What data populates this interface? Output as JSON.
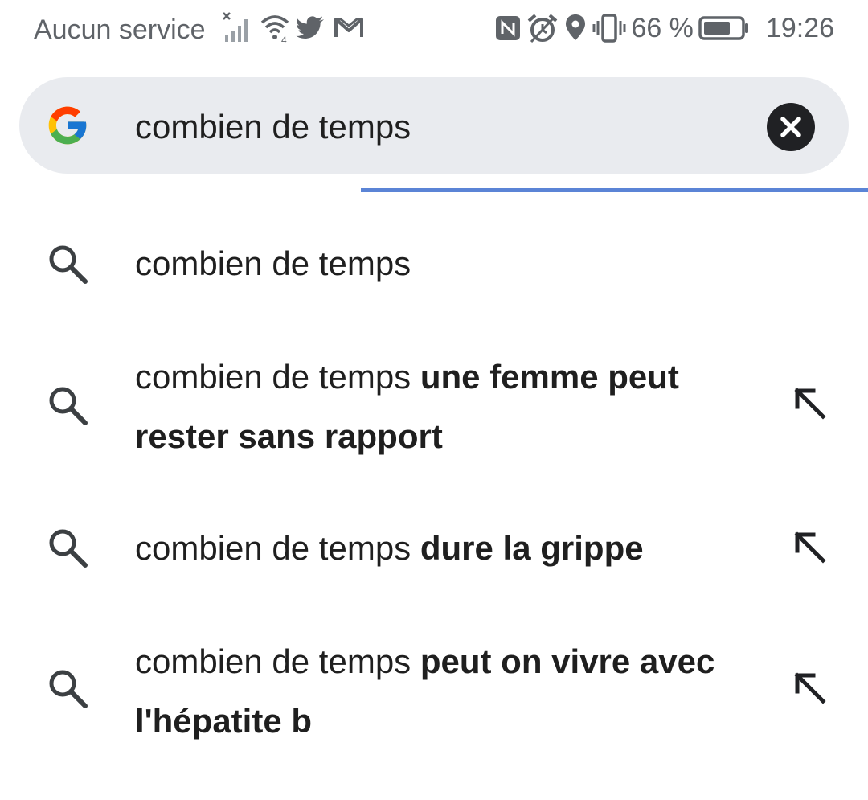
{
  "status_bar": {
    "carrier": "Aucun service",
    "battery_percent": "66 %",
    "time": "19:26",
    "icons_left": [
      "no-signal-icon",
      "wifi-icon",
      "twitter-icon",
      "gmail-icon"
    ],
    "icons_right": [
      "nfc-icon",
      "alarm-icon",
      "location-icon",
      "vibrate-icon",
      "battery-icon"
    ]
  },
  "search": {
    "query": "combien de temps",
    "logo": "google-logo-icon",
    "clear_icon": "clear-icon"
  },
  "suggestions": [
    {
      "prefix": "combien de temps",
      "suffix": "",
      "has_fill_arrow": false
    },
    {
      "prefix": "combien de temps",
      "suffix": "une femme peut rester sans rapport",
      "has_fill_arrow": true
    },
    {
      "prefix": "combien de temps",
      "suffix": "dure la grippe",
      "has_fill_arrow": true
    },
    {
      "prefix": "combien de temps",
      "suffix": "peut on vivre avec l'hépatite b",
      "has_fill_arrow": true
    }
  ],
  "colors": {
    "search_bar_bg": "#e9ebef",
    "progress": "#5b84d6",
    "text": "#1f1f1f",
    "status_text": "#5f6368"
  }
}
